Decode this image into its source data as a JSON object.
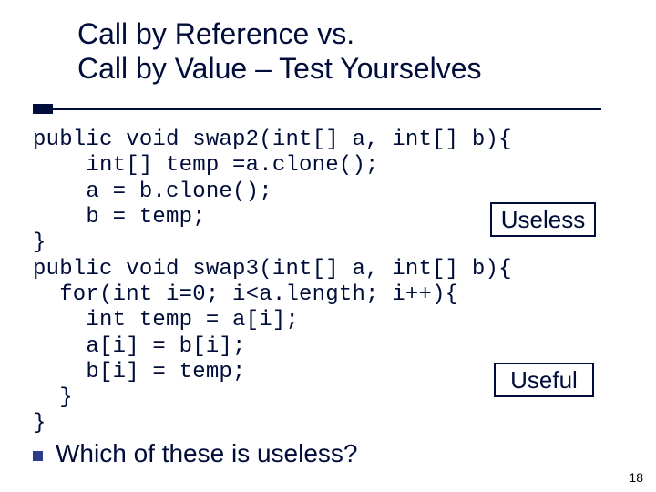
{
  "title_line1": "Call by Reference vs.",
  "title_line2": "Call by Value – Test Yourselves",
  "code": "public void swap2(int[] a, int[] b){\n    int[] temp =a.clone();\n    a = b.clone();\n    b = temp;\n}\npublic void swap3(int[] a, int[] b){\n  for(int i=0; i<a.length; i++){\n    int temp = a[i];\n    a[i] = b[i];\n    b[i] = temp;\n  }\n}",
  "label1": "Useless",
  "label2": "Useful",
  "question": "Which of these is useless?",
  "page_number": "18"
}
